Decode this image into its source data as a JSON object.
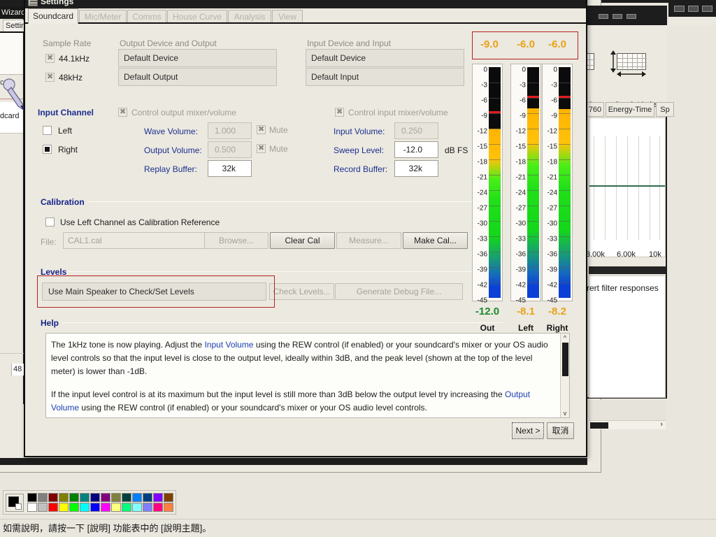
{
  "dialog": {
    "title": "Settings",
    "icon": "settings-window-icon",
    "tabs": [
      {
        "label": "Soundcard",
        "active": true
      },
      {
        "label": "Mic/Meter",
        "active": false
      },
      {
        "label": "Comms",
        "active": false
      },
      {
        "label": "House Curve",
        "active": false
      },
      {
        "label": "Analysis",
        "active": false
      },
      {
        "label": "View",
        "active": false
      }
    ],
    "sample_rate": {
      "caption": "Sample Rate",
      "options": [
        {
          "label": "44.1kHz",
          "checked": true
        },
        {
          "label": "48kHz",
          "checked": true
        }
      ]
    },
    "output_device": {
      "caption": "Output Device and Output",
      "device_value": "Default Device",
      "output_value": "Default Output"
    },
    "input_device": {
      "caption": "Input Device and Input",
      "device_value": "Default Device",
      "input_value": "Default Input"
    },
    "input_channel": {
      "caption": "Input Channel",
      "left_label": "Left",
      "right_label": "Right",
      "selected": "Right"
    },
    "output_controls": {
      "control_mixer_label": "Control output mixer/volume",
      "control_mixer_checked": true,
      "wave_volume_label": "Wave Volume:",
      "wave_volume_value": "1.000",
      "wave_mute_label": "Mute",
      "wave_mute_checked": true,
      "output_volume_label": "Output Volume:",
      "output_volume_value": "0.500",
      "output_mute_label": "Mute",
      "output_mute_checked": true,
      "replay_buffer_label": "Replay Buffer:",
      "replay_buffer_value": "32k"
    },
    "input_controls": {
      "control_mixer_label": "Control input mixer/volume",
      "control_mixer_checked": true,
      "input_volume_label": "Input Volume:",
      "input_volume_value": "0.250",
      "sweep_level_label": "Sweep Level:",
      "sweep_level_value": "-12.0",
      "sweep_level_units": "dB FS",
      "record_buffer_label": "Record Buffer:",
      "record_buffer_value": "32k"
    },
    "calibration": {
      "title": "Calibration",
      "use_left_label": "Use Left Channel as Calibration Reference",
      "use_left_checked": false,
      "file_label": "File:",
      "file_value": "CAL1.cal",
      "browse_label": "Browse...",
      "clear_label": "Clear Cal",
      "measure_label": "Measure...",
      "make_label": "Make Cal..."
    },
    "levels": {
      "title": "Levels",
      "speaker_select_value": "Use Main Speaker to Check/Set Levels",
      "check_levels_label": "Check Levels...",
      "generate_debug_label": "Generate Debug File...",
      "highlight_color": "#b22222"
    },
    "help": {
      "title": "Help",
      "paragraph1_pre": "The 1kHz tone is now playing. Adjust the ",
      "paragraph1_link": "Input Volume",
      "paragraph1_post": " using the REW control (if enabled) or your soundcard's mixer or your OS audio level controls so that the input level is close to the output level, ideally within 3dB, and the peak level (shown at the top of the level meter) is lower than -1dB.",
      "paragraph2_pre": "If the input level control is at its maximum but the input level is still more than 3dB below the output level try increasing the ",
      "paragraph2_link": "Output Volume",
      "paragraph2_post": " using the REW control (if enabled) or your soundcard's mixer or your OS audio level controls."
    },
    "footer": {
      "next_label": "Next >",
      "cancel_label": "取消"
    }
  },
  "meters": {
    "peak_values": [
      "-9.0",
      "-6.0",
      "-6.0"
    ],
    "peak_color": "#e8a317",
    "scale_ticks": [
      "0",
      "-3",
      "-6",
      "-9",
      "-12",
      "-15",
      "-18",
      "-21",
      "-24",
      "-27",
      "-30",
      "-33",
      "-36",
      "-39",
      "-42",
      "-45"
    ],
    "scale_min": -45,
    "scale_max": 0,
    "channels": [
      {
        "name": "Out",
        "value": "-12.0",
        "level_db": -12.0,
        "peak_db": -9.0,
        "value_color": "#1b8a2f"
      },
      {
        "name": "Left",
        "value": "-8.1",
        "level_db": -8.1,
        "peak_db": -6.0,
        "value_color": "#e8a317"
      },
      {
        "name": "Right",
        "value": "-8.2",
        "level_db": -8.2,
        "peak_db": -6.0,
        "value_color": "#e8a317"
      }
    ]
  },
  "behind_left": {
    "menu_label": "Wizard",
    "tab_label": "Settin",
    "text_capture": "cure",
    "text_soundcard": "dcard",
    "field_value": "48"
  },
  "behind_right": {
    "tool_axis_label": "xis",
    "tool_graph_limits_label": "Graph Limits",
    "tabs": [
      "760",
      "Energy-Time",
      "Sp"
    ],
    "axis_labels": [
      "3.00k",
      "6.00k",
      "10k"
    ],
    "panel_text": "rert filter responses"
  },
  "palette": {
    "current_color": "#000000",
    "row1": [
      "#000000",
      "#808080",
      "#800000",
      "#808000",
      "#008000",
      "#008080",
      "#000080",
      "#800080",
      "#808040",
      "#004040",
      "#0080ff",
      "#004080",
      "#8000ff",
      "#804000"
    ],
    "row2": [
      "#ffffff",
      "#c0c0c0",
      "#ff0000",
      "#ffff00",
      "#00ff00",
      "#00ffff",
      "#0000ff",
      "#ff00ff",
      "#ffff80",
      "#00ff80",
      "#80ffff",
      "#8080ff",
      "#ff0080",
      "#ff8040"
    ]
  },
  "statusbar": {
    "text": "如需說明，請按一下 [說明] 功能表中的 [說明主題]。"
  }
}
